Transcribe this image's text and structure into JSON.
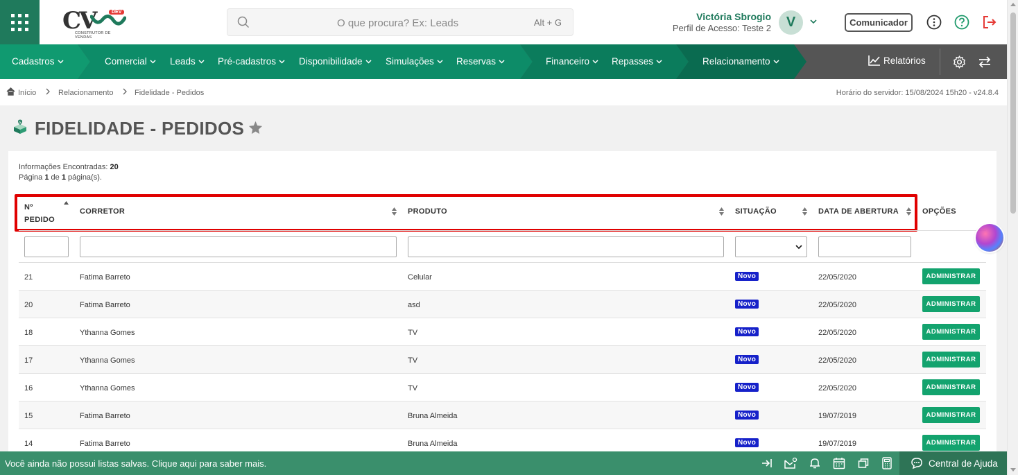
{
  "header": {
    "logo_text": "CV",
    "logo_badge": "DEV",
    "logo_subtitle": "CONSTRUTOR DE VENDAS",
    "search_placeholder": "O que procura? Ex: Leads",
    "search_shortcut": "Alt + G",
    "user_name": "Victória Sbrogio",
    "user_profile": "Perfil de Acesso: Teste 2",
    "avatar_initial": "V",
    "communicator_label": "Comunicador"
  },
  "nav": {
    "items": [
      {
        "label": "Cadastros"
      },
      {
        "label": "Comercial"
      },
      {
        "label": "Leads"
      },
      {
        "label": "Pré-cadastros"
      },
      {
        "label": "Disponibilidade"
      },
      {
        "label": "Simulações"
      },
      {
        "label": "Reservas"
      },
      {
        "label": "Financeiro"
      },
      {
        "label": "Repasses"
      },
      {
        "label": "Relacionamento"
      }
    ],
    "reports_label": "Relatórios",
    "colors": {
      "cadastros": "#109a70",
      "comercial": "#0d8c68",
      "financeiro": "#0b7c5c",
      "relacionamento": "#0a6b50",
      "tools": "#555555"
    }
  },
  "breadcrumb": {
    "home": "Início",
    "level1": "Relacionamento",
    "level2": "Fidelidade - Pedidos",
    "server_time": "Horário do servidor: 15/08/2024 15h20 - v24.8.4"
  },
  "page": {
    "title": "FIDELIDADE - PEDIDOS"
  },
  "results": {
    "found_label": "Informações Encontradas:",
    "found_count": "20",
    "page_prefix": "Página",
    "page_current": "1",
    "page_of": "de",
    "page_total": "1",
    "page_suffix": "página(s)."
  },
  "table": {
    "columns": {
      "pedido_line1": "Nº",
      "pedido_line2": "PEDIDO",
      "corretor": "CORRETOR",
      "produto": "PRODUTO",
      "situacao": "SITUAÇÃO",
      "data": "DATA DE ABERTURA",
      "opcoes": "OPÇÕES"
    },
    "rows": [
      {
        "pedido": "21",
        "corretor": "Fatima Barreto",
        "produto": "Celular",
        "situacao": "Novo",
        "data": "22/05/2020",
        "action": "ADMINISTRAR"
      },
      {
        "pedido": "20",
        "corretor": "Fatima Barreto",
        "produto": "asd",
        "situacao": "Novo",
        "data": "22/05/2020",
        "action": "ADMINISTRAR"
      },
      {
        "pedido": "18",
        "corretor": "Ythanna Gomes",
        "produto": "TV",
        "situacao": "Novo",
        "data": "22/05/2020",
        "action": "ADMINISTRAR"
      },
      {
        "pedido": "17",
        "corretor": "Ythanna Gomes",
        "produto": "TV",
        "situacao": "Novo",
        "data": "22/05/2020",
        "action": "ADMINISTRAR"
      },
      {
        "pedido": "16",
        "corretor": "Ythanna Gomes",
        "produto": "TV",
        "situacao": "Novo",
        "data": "22/05/2020",
        "action": "ADMINISTRAR"
      },
      {
        "pedido": "15",
        "corretor": "Fatima Barreto",
        "produto": "Bruna Almeida",
        "situacao": "Novo",
        "data": "19/07/2019",
        "action": "ADMINISTRAR"
      },
      {
        "pedido": "14",
        "corretor": "Fatima Barreto",
        "produto": "Bruna Almeida",
        "situacao": "Novo",
        "data": "19/07/2019",
        "action": "ADMINISTRAR"
      }
    ]
  },
  "footer": {
    "message": "Você ainda não possui listas salvas. Clique aqui para saber mais.",
    "help_label": "Central de Ajuda"
  }
}
